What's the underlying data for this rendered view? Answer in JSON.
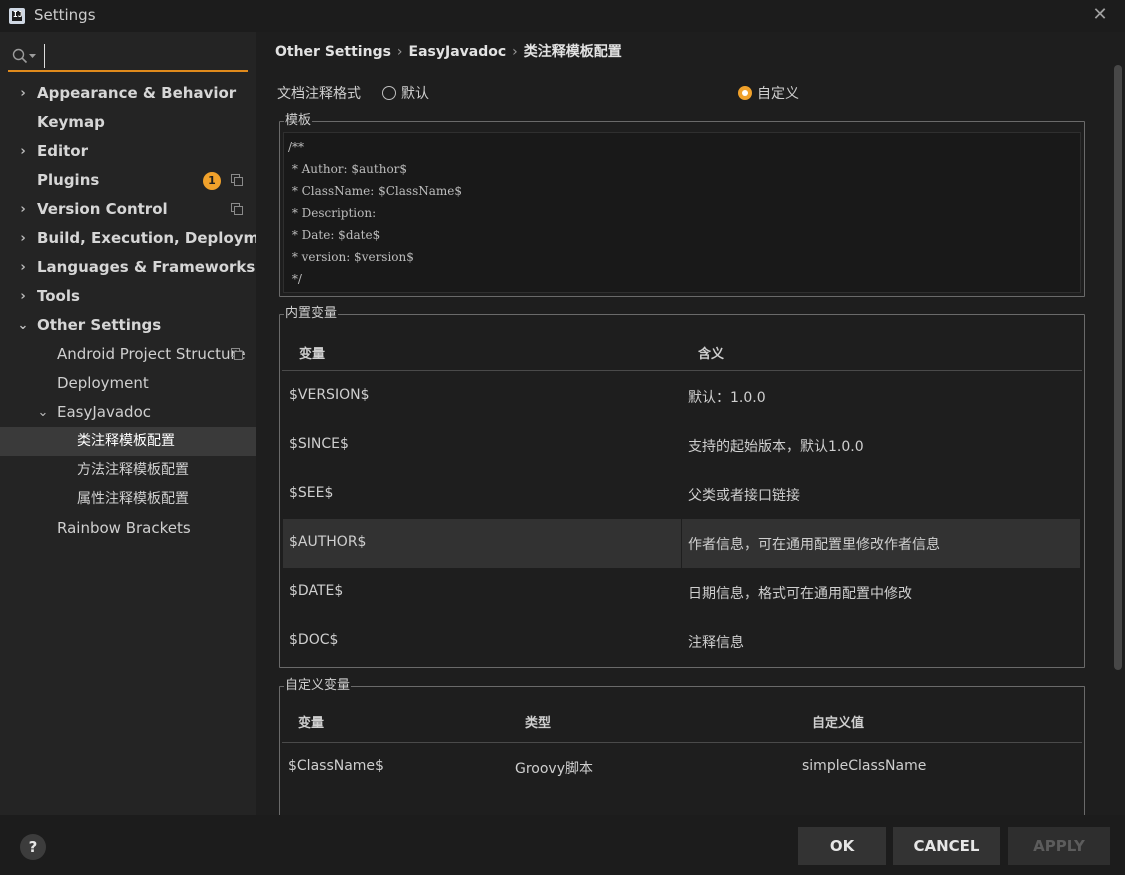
{
  "window": {
    "title": "Settings",
    "app_icon_text": "IJ",
    "close_glyph": "✕"
  },
  "search": {
    "placeholder": "",
    "value": ""
  },
  "sidebar": {
    "items": [
      {
        "label": "Appearance & Behavior",
        "chevron": "›",
        "expanded": false
      },
      {
        "label": "Keymap"
      },
      {
        "label": "Editor",
        "chevron": "›"
      },
      {
        "label": "Plugins",
        "badge": "1"
      },
      {
        "label": "Version Control",
        "chevron": "›"
      },
      {
        "label": "Build, Execution, Deployment",
        "chevron": "›"
      },
      {
        "label": "Languages & Frameworks",
        "chevron": "›"
      },
      {
        "label": "Tools",
        "chevron": "›"
      },
      {
        "label": "Other Settings",
        "chevron": "⌄"
      },
      {
        "label": "Android Project Structure"
      },
      {
        "label": "Deployment"
      },
      {
        "label": "EasyJavadoc",
        "chevron": "⌄"
      },
      {
        "label": "类注释模板配置"
      },
      {
        "label": "方法注释模板配置"
      },
      {
        "label": "属性注释模板配置"
      },
      {
        "label": "Rainbow Brackets"
      }
    ]
  },
  "breadcrumb": [
    "Other Settings",
    "EasyJavadoc",
    "类注释模板配置"
  ],
  "breadcrumb_sep": "›",
  "format": {
    "label": "文档注释格式",
    "option_default": "默认",
    "option_custom": "自定义",
    "selected": "custom"
  },
  "template": {
    "title": "模板",
    "lines": [
      "/**",
      " * Author: $author$",
      " * ClassName: $ClassName$",
      " * Description:",
      " * Date: $date$",
      " * version: $version$",
      " */"
    ]
  },
  "builtin_vars": {
    "title": "内置变量",
    "headers": [
      "变量",
      "含义"
    ],
    "rows": [
      [
        "$VERSION$",
        "默认：1.0.0"
      ],
      [
        "$SINCE$",
        "支持的起始版本，默认1.0.0"
      ],
      [
        "$SEE$",
        "父类或者接口链接"
      ],
      [
        "$AUTHOR$",
        "作者信息，可在通用配置里修改作者信息"
      ],
      [
        "$DATE$",
        "日期信息，格式可在通用配置中修改"
      ],
      [
        "$DOC$",
        "注释信息"
      ]
    ]
  },
  "custom_vars": {
    "title": "自定义变量",
    "headers": [
      "变量",
      "类型",
      "自定义值"
    ],
    "rows": [
      [
        "$ClassName$",
        "Groovy脚本",
        "simpleClassName"
      ]
    ]
  },
  "footer": {
    "help": "?",
    "ok": "OK",
    "cancel": "CANCEL",
    "apply": "APPLY"
  },
  "colors": {
    "accent": "#f0a12b",
    "search_underline": "#e08a1c"
  }
}
